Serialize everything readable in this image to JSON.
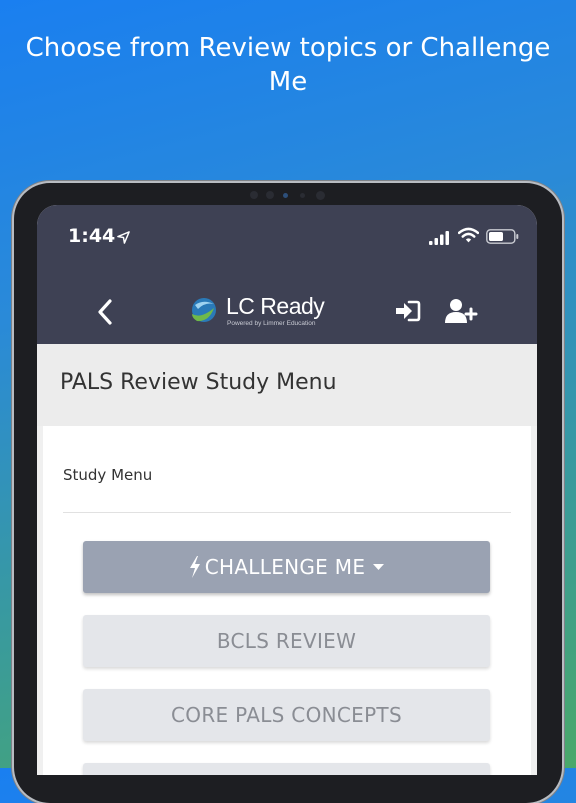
{
  "headline": "Choose from Review topics or Challenge Me",
  "status_bar": {
    "time": "1:44"
  },
  "nav": {
    "logo_text": "LC Ready",
    "logo_subtitle": "Powered by Limmer Education"
  },
  "page": {
    "title": "PALS Review Study Menu",
    "card_title": "Study Menu"
  },
  "menu": {
    "challenge_label": "CHALLENGE ME",
    "items": [
      "BCLS REVIEW",
      "CORE PALS CONCEPTS",
      ""
    ]
  },
  "colors": {
    "topbar": "#3e4154",
    "primary_button": "#9aa2b2",
    "secondary_button": "#e4e6ea"
  },
  "icons": [
    "location-arrow-icon",
    "signal-icon",
    "wifi-icon",
    "battery-icon",
    "back-chevron-icon",
    "sign-in-icon",
    "add-user-icon",
    "bolt-icon",
    "caret-down-icon"
  ]
}
